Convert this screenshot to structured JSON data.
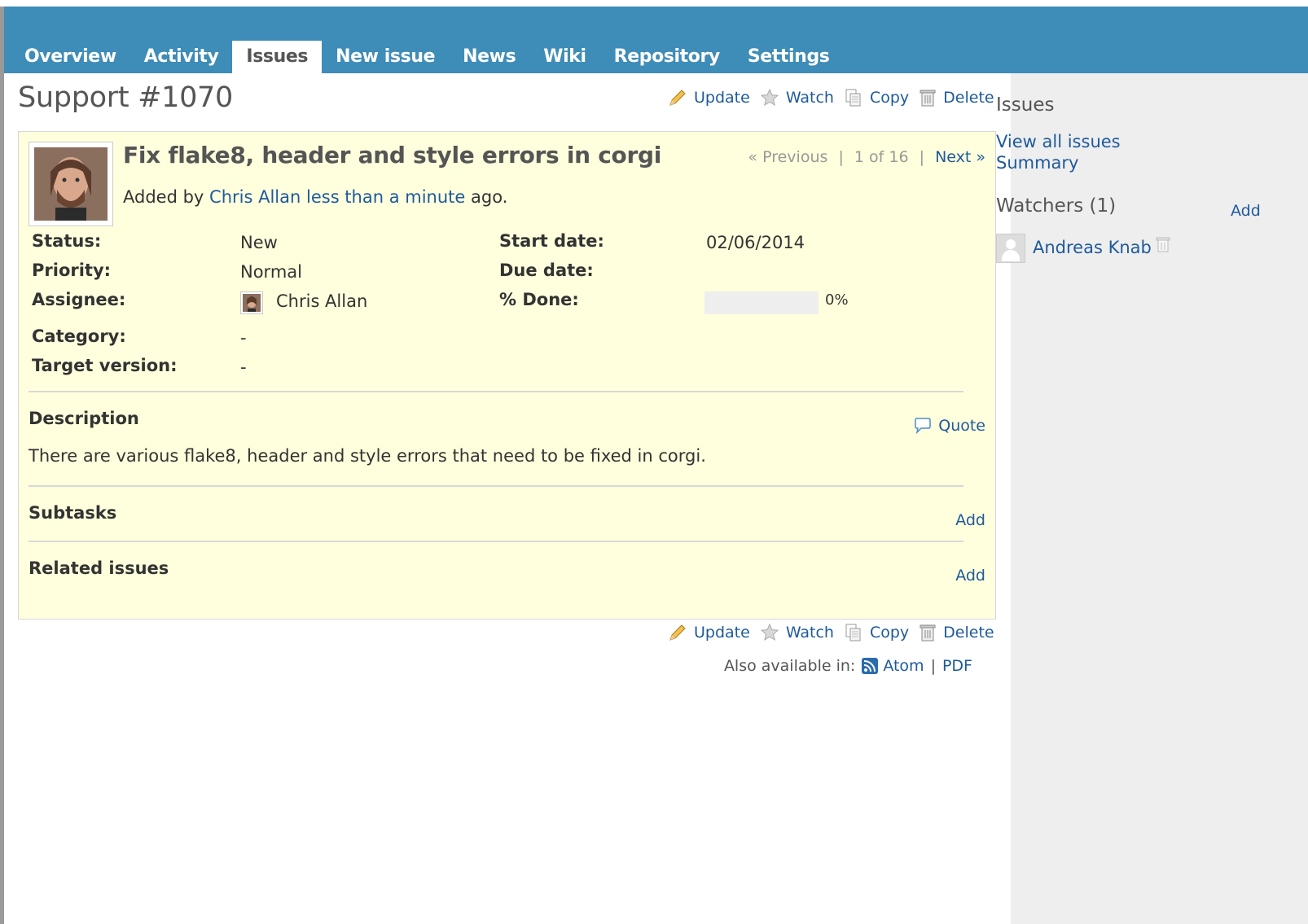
{
  "nav_tabs": [
    {
      "label": "Overview",
      "selected": false
    },
    {
      "label": "Activity",
      "selected": false
    },
    {
      "label": "Issues",
      "selected": true
    },
    {
      "label": "New issue",
      "selected": false
    },
    {
      "label": "News",
      "selected": false
    },
    {
      "label": "Wiki",
      "selected": false
    },
    {
      "label": "Repository",
      "selected": false
    },
    {
      "label": "Settings",
      "selected": false
    }
  ],
  "page": {
    "title": "Support #1070"
  },
  "actions": {
    "update": "Update",
    "watch": "Watch",
    "copy": "Copy",
    "delete": "Delete"
  },
  "issue": {
    "subject": "Fix flake8, header and style errors in corgi",
    "added_prefix": "Added by",
    "author": "Chris Allan",
    "time_ago": "less than a minute",
    "added_suffix": "ago.",
    "nav": {
      "previous": "« Previous",
      "position": "1 of 16",
      "next": "Next »"
    },
    "attributes": {
      "status_label": "Status:",
      "status": "New",
      "priority_label": "Priority:",
      "priority": "Normal",
      "assignee_label": "Assignee:",
      "assignee": "Chris Allan",
      "category_label": "Category:",
      "category": "-",
      "target_version_label": "Target version:",
      "target_version": "-",
      "start_date_label": "Start date:",
      "start_date": "02/06/2014",
      "due_date_label": "Due date:",
      "due_date": "",
      "done_label": "% Done:",
      "done_text": "0%",
      "done_fraction": 0
    },
    "description": {
      "title": "Description",
      "quote": "Quote",
      "text": "There are various flake8, header and style errors that need to be fixed in corgi."
    },
    "subtasks": {
      "title": "Subtasks",
      "add": "Add"
    },
    "related": {
      "title": "Related issues",
      "add": "Add"
    }
  },
  "also_available": {
    "label": "Also available in:",
    "atom": "Atom",
    "separator": "|",
    "pdf": "PDF"
  },
  "sidebar": {
    "issues_title": "Issues",
    "view_all": "View all issues",
    "summary": "Summary",
    "watchers_title": "Watchers (1)",
    "watchers_add": "Add",
    "watchers": [
      "Andreas Knab"
    ]
  },
  "colors": {
    "header_bg": "#3e8cb8",
    "issue_bg": "#ffffdd",
    "link": "#1e5a9c",
    "sidebar_bg": "#eeeeee"
  },
  "icons": [
    "pencil-icon",
    "star-icon",
    "copy-icon",
    "trash-icon",
    "comment-icon",
    "feed-icon",
    "avatar-icon"
  ]
}
